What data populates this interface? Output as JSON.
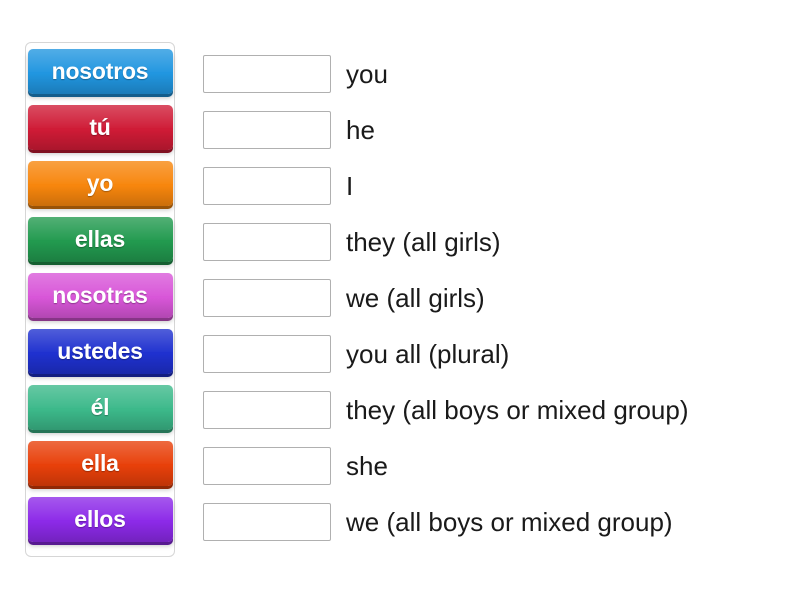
{
  "activity": {
    "type": "match-up-drag-and-drop",
    "background_color": "#ffffff"
  },
  "tile_well": {
    "name": "Spanish subject pronouns",
    "border_color": "#d6d6d6",
    "tiles": [
      {
        "label": "nosotros",
        "color": "#2196e0",
        "text_color": "#ffffff"
      },
      {
        "label": "tú",
        "color": "#cf1b36",
        "text_color": "#ffffff"
      },
      {
        "label": "yo",
        "color": "#f7860d",
        "text_color": "#ffffff"
      },
      {
        "label": "ellas",
        "color": "#229a4f",
        "text_color": "#ffffff"
      },
      {
        "label": "nosotras",
        "color": "#d856d8",
        "text_color": "#ffffff"
      },
      {
        "label": "ustedes",
        "color": "#1f31cf",
        "text_color": "#ffffff"
      },
      {
        "label": "él",
        "color": "#3cb98a",
        "text_color": "#ffffff"
      },
      {
        "label": "ella",
        "color": "#e8400a",
        "text_color": "#ffffff"
      },
      {
        "label": "ellos",
        "color": "#8c2ae8",
        "text_color": "#ffffff"
      }
    ]
  },
  "answer_rows": [
    {
      "input_value": "",
      "placeholder": "",
      "prompt": "you"
    },
    {
      "input_value": "",
      "placeholder": "",
      "prompt": "he"
    },
    {
      "input_value": "",
      "placeholder": "",
      "prompt": "I"
    },
    {
      "input_value": "",
      "placeholder": "",
      "prompt": "they (all girls)"
    },
    {
      "input_value": "",
      "placeholder": "",
      "prompt": "we (all girls)"
    },
    {
      "input_value": "",
      "placeholder": "",
      "prompt": "you all (plural)"
    },
    {
      "input_value": "",
      "placeholder": "",
      "prompt": "they (all boys or mixed group)"
    },
    {
      "input_value": "",
      "placeholder": "",
      "prompt": "she"
    },
    {
      "input_value": "",
      "placeholder": "",
      "prompt": "we (all boys or mixed group)"
    }
  ]
}
